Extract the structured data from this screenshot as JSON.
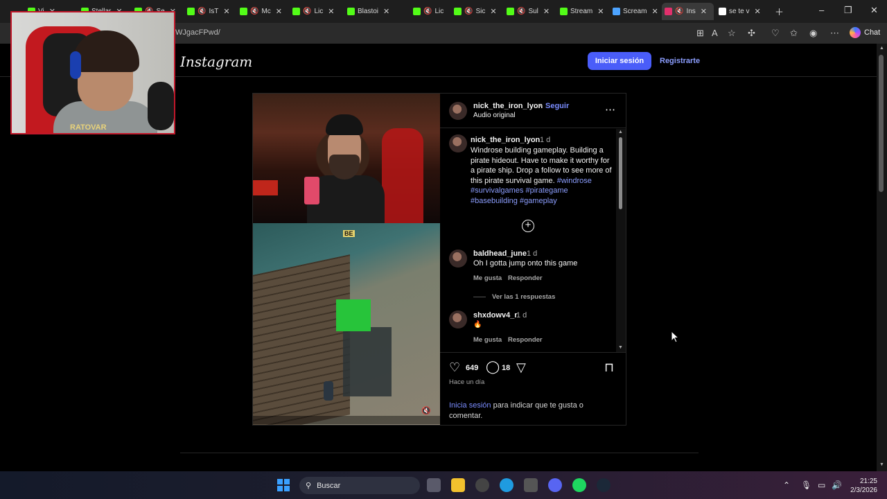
{
  "browser": {
    "tabs": [
      {
        "label": "Vi",
        "color": "#53fc18"
      },
      {
        "label": "Stellar",
        "color": "#53fc18"
      },
      {
        "label": "Se",
        "color": "#53fc18"
      },
      {
        "label": "IsT",
        "color": "#53fc18"
      },
      {
        "label": "Mc",
        "color": "#53fc18"
      },
      {
        "label": "Lic",
        "color": "#53fc18"
      },
      {
        "label": "Blastoi",
        "color": "#53fc18"
      },
      {
        "label": "Lic",
        "color": "#53fc18"
      },
      {
        "label": "Sic",
        "color": "#53fc18"
      },
      {
        "label": "Sul",
        "color": "#53fc18"
      },
      {
        "label": "Stream",
        "color": "#53fc18"
      },
      {
        "label": "Scream",
        "color": "#4ca3ff"
      },
      {
        "label": "Ins",
        "color": "#e1306c"
      },
      {
        "label": "se te v",
        "color": "#ffffff"
      }
    ],
    "url_fragment": "WJgacFPwd/",
    "chat_label": "Chat"
  },
  "instagram": {
    "logo": "Instagram",
    "login_button": "Iniciar sesión",
    "signup_link": "Registrarte"
  },
  "post": {
    "author": "nick_the_iron_lyon",
    "follow": "Seguir",
    "separator": "•",
    "audio": "Audio original",
    "caption_author": "nick_the_iron_lyon",
    "caption_age": "1 d",
    "caption_text": "Windrose building gameplay. Building a pirate hideout. Have to make it worthy for a pirate ship. Drop a follow to see more of this pirate survival game.",
    "hashtags": "#windrose #survivalgames #pirategame #basebuilding #gameplay",
    "overlay_label": "BE",
    "comments": [
      {
        "user": "baldhead_june",
        "age": "1 d",
        "text": "Oh I gotta jump onto this game",
        "like": "Me gusta",
        "reply": "Responder",
        "replies_link": "Ver las 1 respuestas"
      },
      {
        "user": "shxdowv4_r",
        "age": "1 d",
        "text": "🔥",
        "like": "Me gusta",
        "reply": "Responder"
      }
    ],
    "likes": "649",
    "comment_count": "18",
    "posted": "Hace un día",
    "login_prompt_link": "Inicia sesión",
    "login_prompt_rest": " para indicar que te gusta o comentar."
  },
  "webcam": {
    "shirt_text": "RATOVAR"
  },
  "taskbar": {
    "search_label": "Buscar",
    "time": "21:25",
    "date": "2/3/2026"
  }
}
